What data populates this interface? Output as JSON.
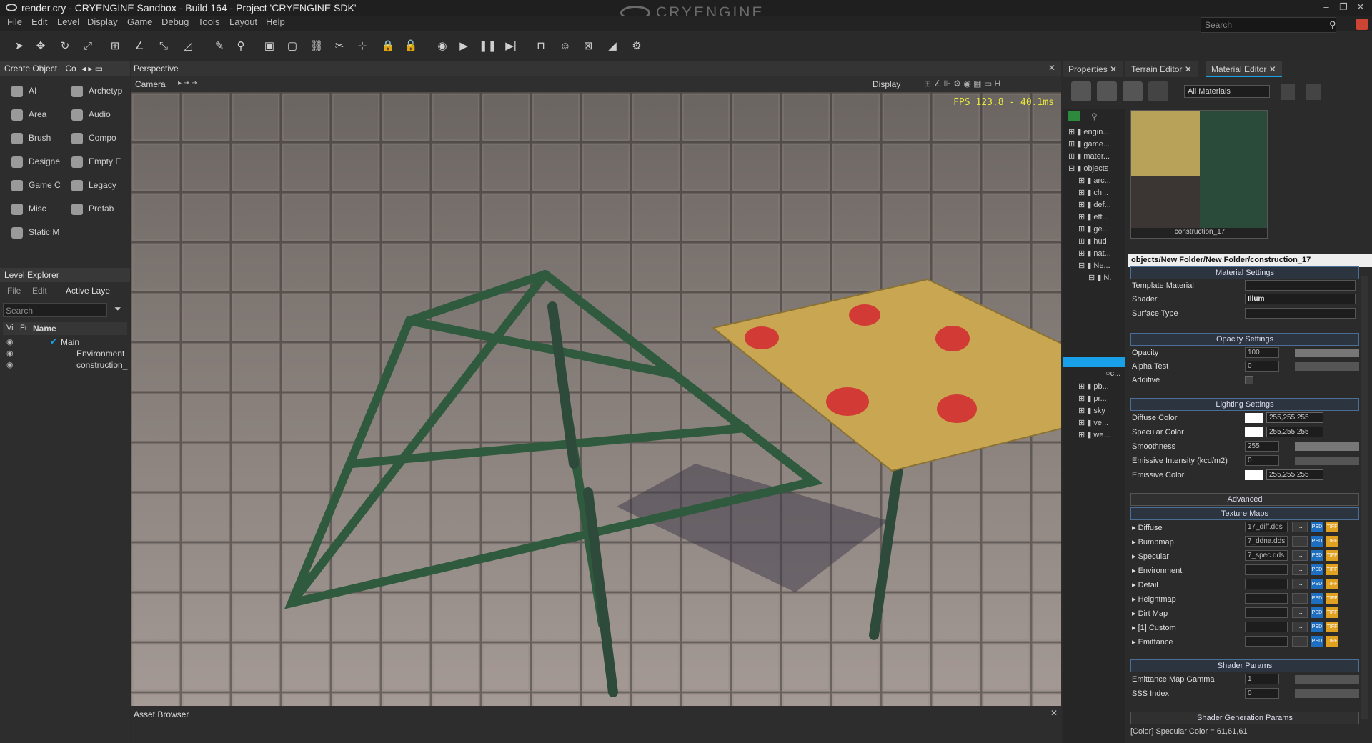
{
  "window": {
    "title": "render.cry - CRYENGINE Sandbox - Build 164 - Project 'CRYENGINE SDK'",
    "brand": "CRYENGINE"
  },
  "menu": [
    "File",
    "Edit",
    "Level",
    "Display",
    "Game",
    "Debug",
    "Tools",
    "Layout",
    "Help"
  ],
  "search": {
    "placeholder": "Search"
  },
  "create_object": {
    "tab": "Create Object",
    "tab2": "Co",
    "items": [
      "AI",
      "Archetyp",
      "Area",
      "Audio",
      "Brush",
      "Compo",
      "Designe",
      "Empty E",
      "Game C",
      "Legacy",
      "Misc",
      "Prefab",
      "Static M"
    ]
  },
  "level_explorer": {
    "title": "Level Explorer",
    "menu": [
      "File",
      "Edit",
      "Active Laye"
    ],
    "search_placeholder": "Search",
    "columns": [
      "Vi",
      "Fr",
      "Name"
    ],
    "rows": [
      "Main",
      "Environment",
      "construction_"
    ]
  },
  "viewport": {
    "title": "Perspective",
    "camera": "Camera",
    "display": "Display",
    "fps": "FPS 123.8 - 40.1ms"
  },
  "asset_browser": {
    "title": "Asset Browser"
  },
  "right_tabs": [
    "Properties",
    "Terrain Editor",
    "Material Editor"
  ],
  "material_filter": "All Materials",
  "tree": [
    "engin...",
    "game...",
    "mater...",
    "objects",
    "arc...",
    "ch...",
    "def...",
    "eff...",
    "ge...",
    "hud",
    "nat...",
    "Ne...",
    "N.",
    "c...",
    "pb...",
    "pr...",
    "sky",
    "ve...",
    "we..."
  ],
  "preview_name": "construction_17",
  "material_path": "objects/New Folder/New Folder/construction_17",
  "material_settings": {
    "title": "Material Settings",
    "template_label": "Template Material",
    "shader_label": "Shader",
    "shader_value": "Illum",
    "surface_label": "Surface Type"
  },
  "opacity": {
    "title": "Opacity Settings",
    "opacity_label": "Opacity",
    "opacity_value": "100",
    "alpha_label": "Alpha Test",
    "alpha_value": "0",
    "additive_label": "Additive"
  },
  "lighting": {
    "title": "Lighting Settings",
    "diffuse_label": "Diffuse Color",
    "diffuse_value": "255,255,255",
    "specular_label": "Specular Color",
    "specular_value": "255,255,255",
    "smooth_label": "Smoothness",
    "smooth_value": "255",
    "emint_label": "Emissive Intensity (kcd/m2)",
    "emint_value": "0",
    "emcol_label": "Emissive Color",
    "emcol_value": "255,255,255"
  },
  "advanced": "Advanced",
  "texture_maps": {
    "title": "Texture Maps",
    "rows": [
      {
        "label": "Diffuse",
        "value": "17_diff.dds"
      },
      {
        "label": "Bumpmap",
        "value": "7_ddna.dds"
      },
      {
        "label": "Specular",
        "value": "7_spec.dds"
      },
      {
        "label": "Environment",
        "value": ""
      },
      {
        "label": "Detail",
        "value": ""
      },
      {
        "label": "Heightmap",
        "value": ""
      },
      {
        "label": "Dirt Map",
        "value": ""
      },
      {
        "label": "[1] Custom",
        "value": ""
      },
      {
        "label": "Emittance",
        "value": ""
      }
    ],
    "browse": "...",
    "psd": "PSD",
    "tif": "TIFF"
  },
  "shader_params": {
    "title": "Shader Params",
    "gamma_label": "Emittance Map Gamma",
    "gamma_value": "1",
    "sss_label": "SSS Index",
    "sss_value": "0"
  },
  "shader_gen": {
    "title": "Shader Generation Params"
  },
  "status": "[Color] Specular Color = 61,61,61"
}
